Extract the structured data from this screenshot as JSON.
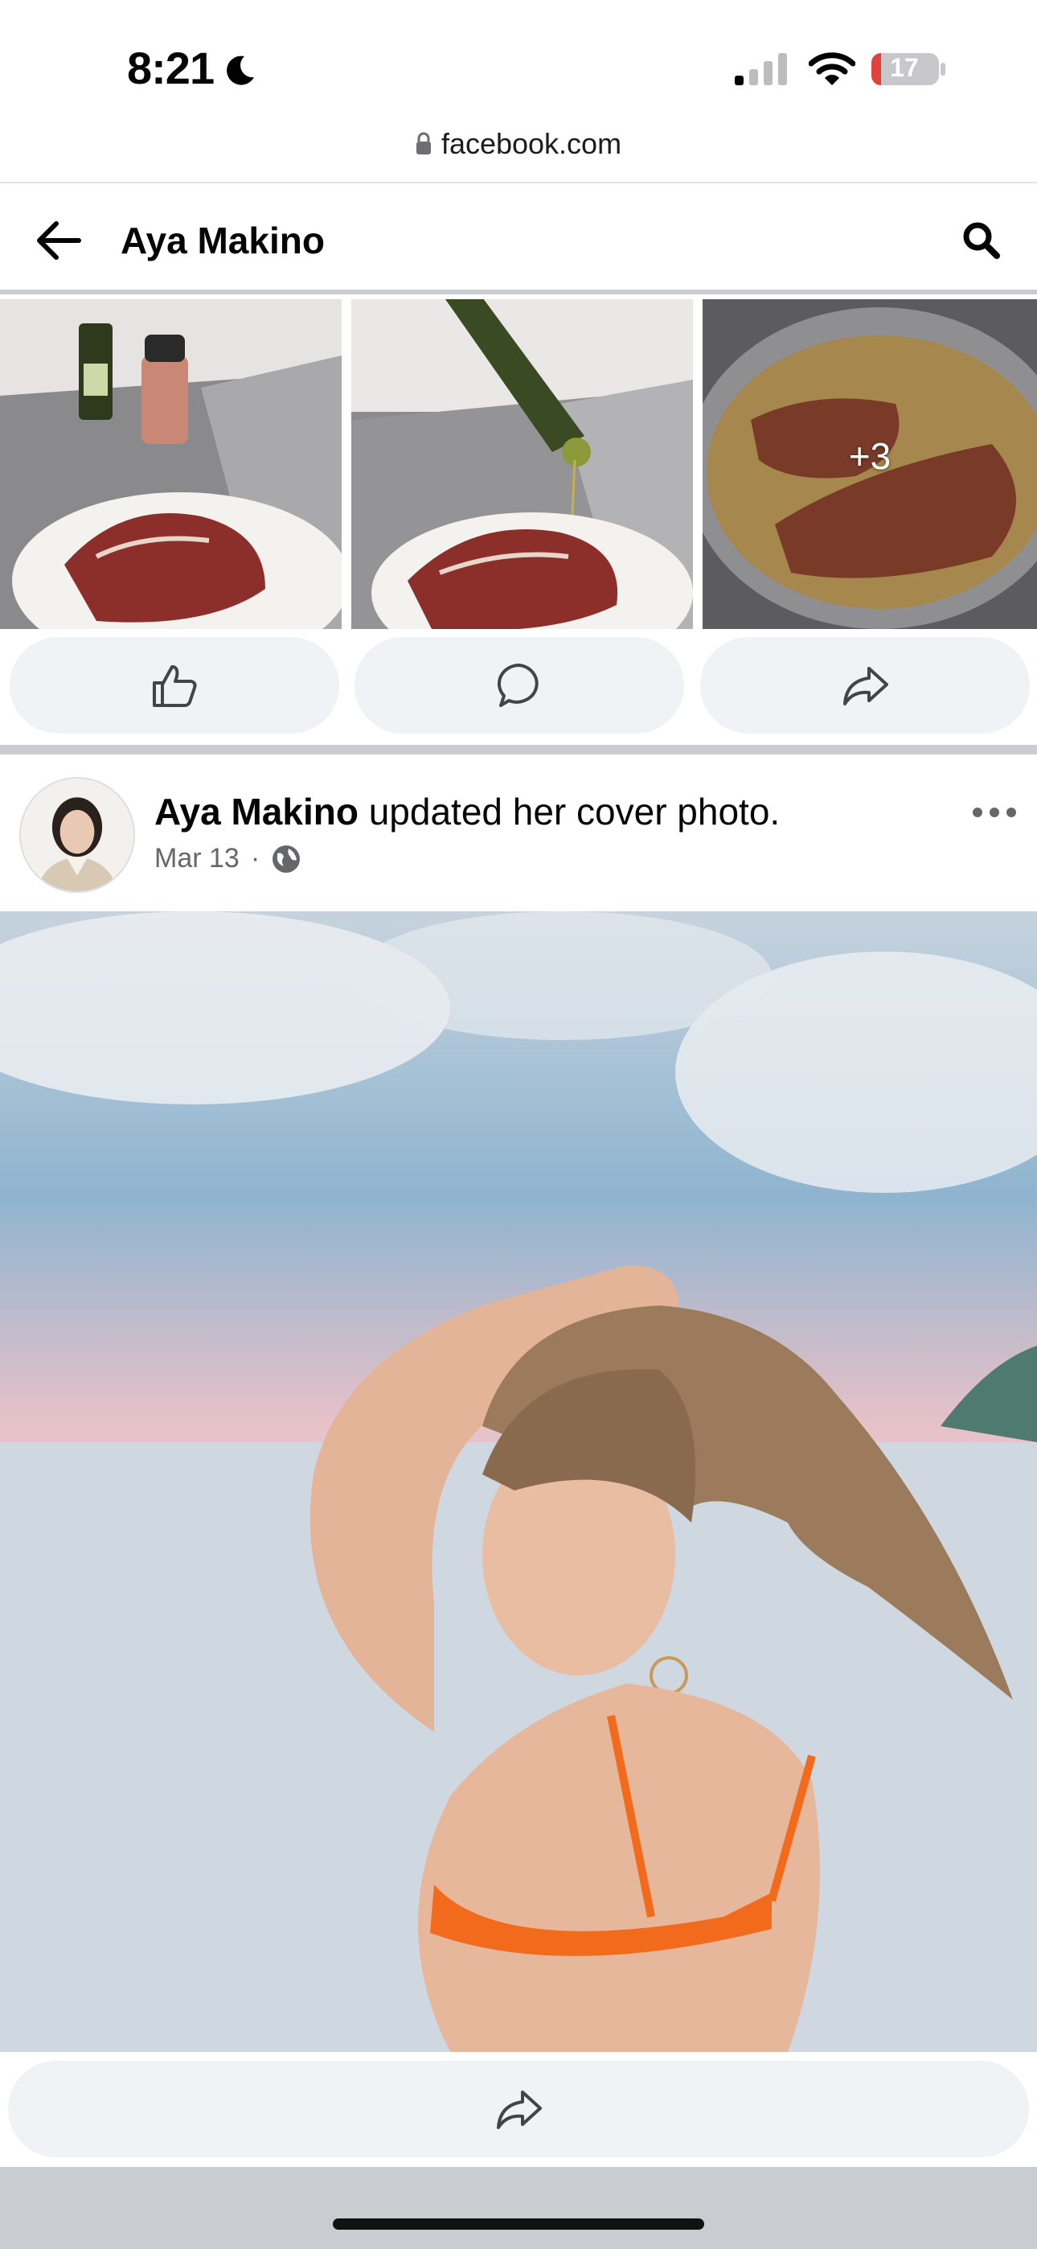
{
  "status_bar": {
    "time": "8:21",
    "battery_level": "17",
    "icons": [
      "moon-icon",
      "cellular-signal-icon",
      "wifi-icon",
      "battery-icon"
    ]
  },
  "browser": {
    "url": "facebook.com"
  },
  "header": {
    "title": "Aya Makino",
    "icons": [
      "back-arrow-icon",
      "search-icon"
    ]
  },
  "photo_grid": {
    "more_count": "+3"
  },
  "post_actions": {
    "icons": [
      "like-icon",
      "comment-icon",
      "share-icon"
    ]
  },
  "post": {
    "author": "Aya Makino",
    "action_text": "updated her cover photo.",
    "date": "Mar 13",
    "separator": "·",
    "privacy_icon": "globe-icon",
    "menu_icon": "more-horizontal-icon"
  },
  "cover_actions": {
    "icons": [
      "share-icon"
    ]
  },
  "colors": {
    "button_bg": "#f0f2f5",
    "divider": "#c9ccd1",
    "meta_text": "#65676b",
    "battery_low": "#e0413a"
  }
}
